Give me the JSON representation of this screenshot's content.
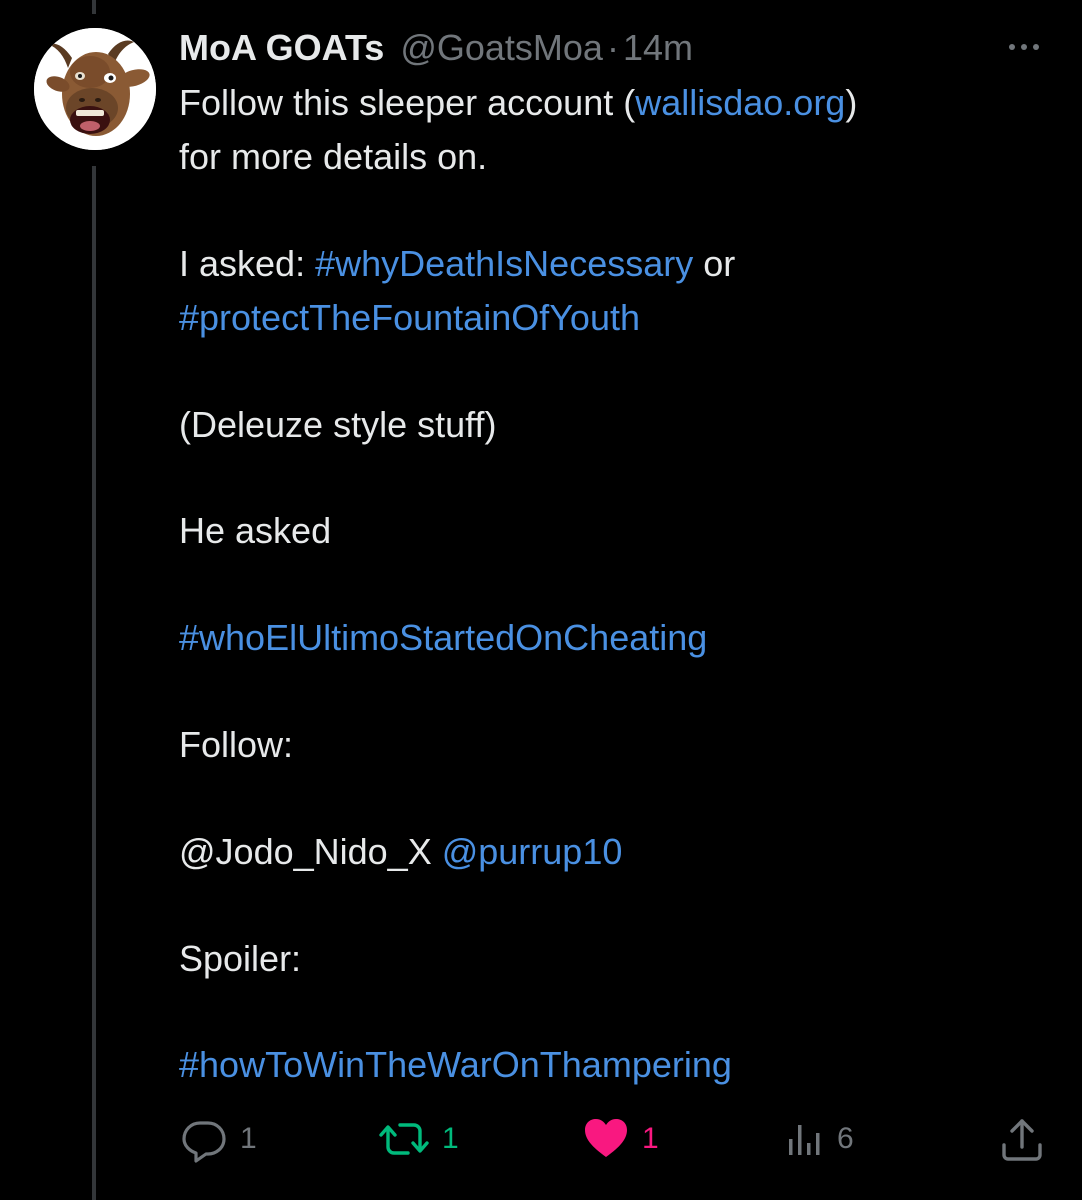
{
  "tweet": {
    "author_name": "MoA GOATs",
    "author_handle": "@GoatsMoa",
    "separator": "·",
    "timestamp": "14m",
    "avatar_icon": "goat-avatar-icon",
    "more_icon": "more-options-icon",
    "lines": {
      "l1a": "Follow this sleeper account (",
      "l1b": "wallisdao.org",
      "l1c": ")",
      "l2": "for more details on.",
      "l3a": "I asked: ",
      "l3b": "#whyDeathIsNecessary",
      "l3c": " or",
      "l4": "#protectTheFountainOfYouth",
      "l5": "(Deleuze style stuff)",
      "l6": "He asked",
      "l7": "#whoElUltimoStartedOnCheating",
      "l8": "Follow:",
      "l9a": "@Jodo_Nido_X ",
      "l9b": "@purrup10",
      "l10": "Spoiler:",
      "l11": "#howToWinTheWarOnThampering"
    }
  },
  "actions": {
    "reply_count": "1",
    "repost_count": "1",
    "like_count": "1",
    "views_count": "6",
    "reply_icon": "reply-icon",
    "repost_icon": "repost-icon",
    "like_icon": "heart-icon",
    "views_icon": "views-icon",
    "share_icon": "share-icon"
  },
  "colors": {
    "background": "#000000",
    "text": "#e7e9ea",
    "muted": "#71767b",
    "link": "#4a90e2",
    "repost": "#00ba7c",
    "like": "#f91880",
    "thread_line": "#333639"
  }
}
